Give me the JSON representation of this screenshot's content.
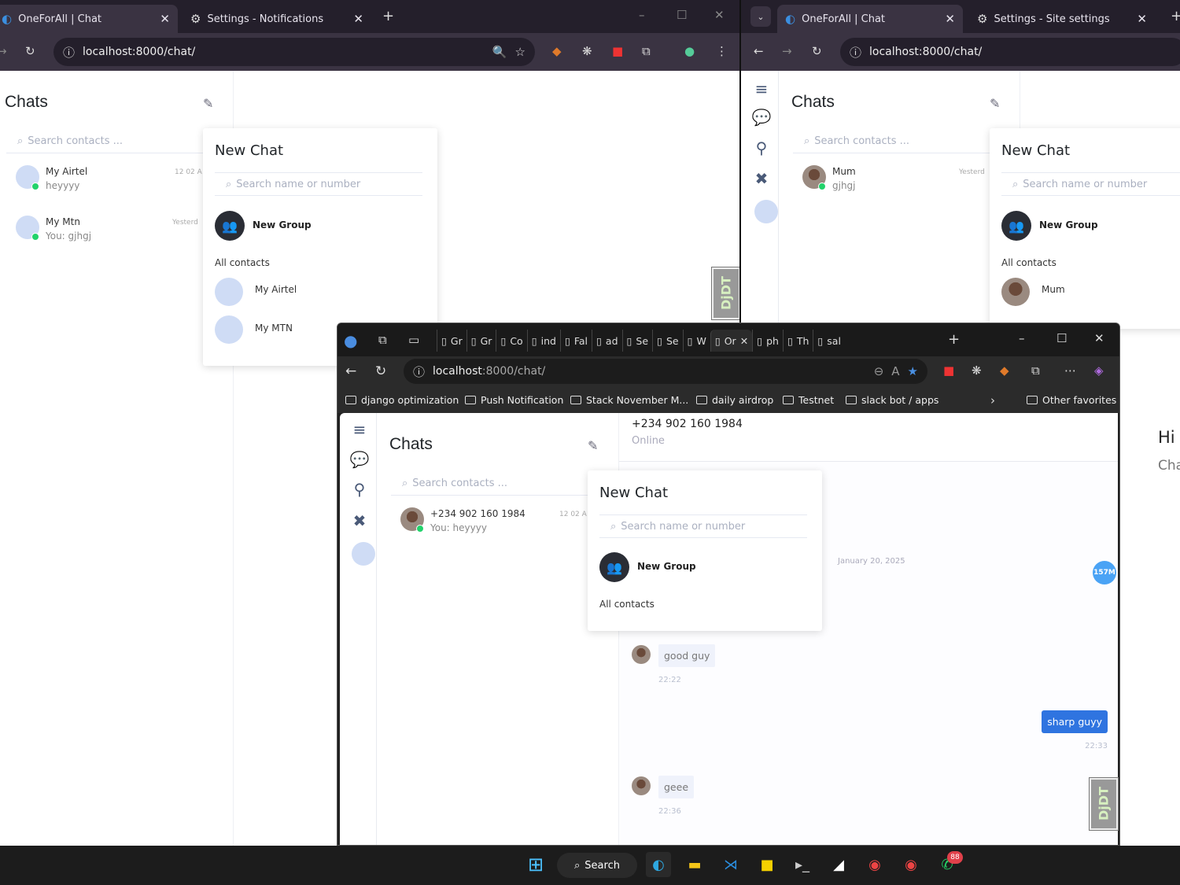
{
  "window_a": {
    "tabs": [
      {
        "label": "OneForAll | Chat"
      },
      {
        "label": "Settings - Notifications"
      }
    ],
    "url": "localhost:8000/chat/",
    "chats": {
      "title": "Chats",
      "search_placeholder": "Search contacts ...",
      "items": [
        {
          "name": "My Airtel",
          "message": "heyyyy",
          "time": "12 02 A"
        },
        {
          "name": "My Mtn",
          "message": "You: gjhgj",
          "time": "Yesterd"
        }
      ]
    },
    "new_chat": {
      "title": "New Chat",
      "search_placeholder": "Search name or number",
      "new_group": "New Group",
      "all_contacts": "All contacts",
      "contacts": [
        {
          "name": "My Airtel"
        },
        {
          "name": "My MTN"
        }
      ]
    },
    "djdt": "DjDT"
  },
  "window_b": {
    "tabs": [
      {
        "label": "OneForAll | Chat"
      },
      {
        "label": "Settings - Site settings"
      }
    ],
    "url": "localhost:8000/chat/",
    "chats": {
      "title": "Chats",
      "search_placeholder": "Search contacts ...",
      "items": [
        {
          "name": "Mum",
          "message": "gjhgj",
          "time": "Yesterd"
        }
      ]
    },
    "new_chat": {
      "title": "New Chat",
      "search_placeholder": "Search name or number",
      "new_group": "New Group",
      "all_contacts": "All contacts",
      "contacts": [
        {
          "name": "Mum"
        }
      ]
    },
    "behind_text": {
      "hi": "Hi",
      "cha": "Cha"
    }
  },
  "window_c": {
    "tabs": [
      "Gr",
      "Gr",
      "Co",
      "ind",
      "Fal",
      "ad",
      "Se",
      "Se",
      "W",
      "Or",
      "ph",
      "Th",
      "sal"
    ],
    "url_host": "localhost",
    "url_path": ":8000/chat/",
    "bookmarks": [
      "django optimization",
      "Push Notification",
      "Stack November M...",
      "daily airdrop",
      "Testnet",
      "slack bot / apps"
    ],
    "other_favorites": "Other favorites",
    "chats": {
      "title": "Chats",
      "search_placeholder": "Search contacts ...",
      "items": [
        {
          "name": "+234 902 160 1984",
          "message": "You: heyyyy",
          "time": "12 02 A"
        }
      ]
    },
    "conversation": {
      "contact": "+234 902 160 1984",
      "status": "Online",
      "date": "January 20, 2025",
      "badge": "157M",
      "messages": [
        {
          "text": "good guy",
          "time": "22:22",
          "dir": "in"
        },
        {
          "text": "sharp guyy",
          "time": "22:33",
          "dir": "out"
        },
        {
          "text": "geee",
          "time": "22:36",
          "dir": "in"
        }
      ]
    },
    "new_chat": {
      "title": "New Chat",
      "search_placeholder": "Search name or number",
      "new_group": "New Group",
      "all_contacts": "All contacts"
    },
    "djdt": "DjDT"
  },
  "taskbar": {
    "search_label": "Search",
    "whatsapp_badge": "88"
  },
  "colors": {
    "accent": "#2f74e0",
    "online": "#22d36b",
    "chrome_dark": "#2c2633",
    "edge_dark": "#202020"
  }
}
